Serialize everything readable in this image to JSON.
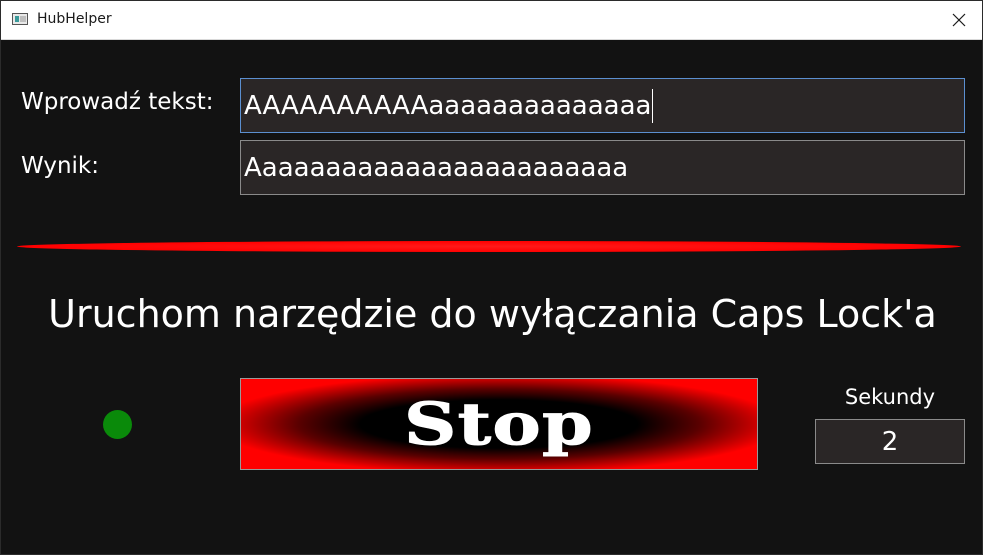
{
  "window": {
    "title": "HubHelper"
  },
  "icons": {
    "app": "app-window-icon",
    "close": "close-icon",
    "status": "status-indicator-dot"
  },
  "form": {
    "input_label": "Wprowadź tekst:",
    "input_value": "AAAAAAAAAAaaaaaaaaaaaaaa",
    "result_label": "Wynik:",
    "result_value": "Aaaaaaaaaaaaaaaaaaaaaaaa"
  },
  "caps_tool": {
    "heading": "Uruchom narzędzie do wyłączania Caps Lock'a",
    "button_label": "Stop",
    "seconds_label": "Sekundy",
    "seconds_value": "2"
  },
  "colors": {
    "background": "#121212",
    "textbox_bg": "#2a2626",
    "separator": "#ff0000",
    "status_active": "#0a8a0a",
    "focus_border": "#5b8fd0"
  }
}
